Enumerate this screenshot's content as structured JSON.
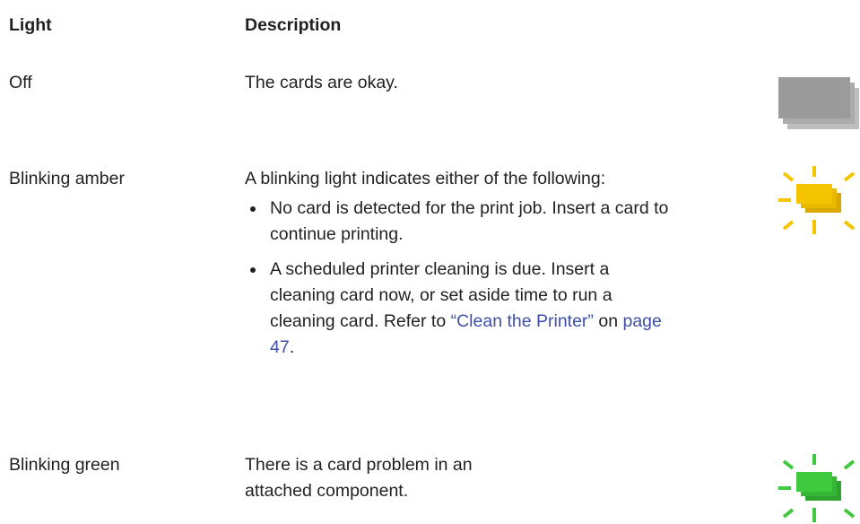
{
  "headers": {
    "light": "Light",
    "description": "Description"
  },
  "rows": [
    {
      "light": "Off",
      "description": "The cards are okay.",
      "icon": "card-stack-off-icon"
    },
    {
      "light": "Blinking amber",
      "description": "A blinking light indicates either of the following:",
      "icon": "card-stack-blinking-amber-icon",
      "bullets": [
        "No card is detected for the print job. Insert a card to continue printing.",
        {
          "text": "A scheduled printer cleaning is due. Insert a cleaning card now, or set aside time to run a cleaning card. Refer to ",
          "link1": "“Clean the Printer”",
          "mid": " on ",
          "link2": "page 47",
          "end": "."
        }
      ]
    },
    {
      "light": "Blinking green",
      "description": "There is a card problem in an attached component.",
      "icon": "card-stack-blinking-green-icon"
    }
  ],
  "colors": {
    "off": "#9b9b9b",
    "amber": "#f5c400",
    "green": "#3fc93f",
    "link": "#3d4fa8"
  }
}
